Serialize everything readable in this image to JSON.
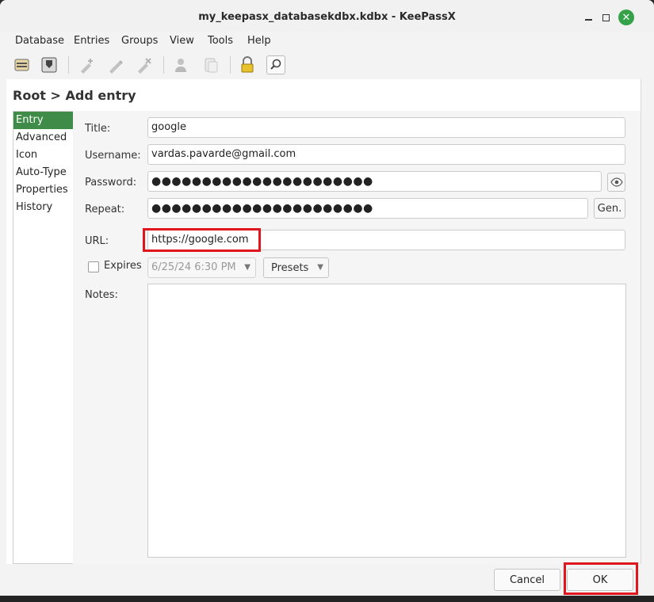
{
  "window": {
    "title": "my_keepasx_databasekdbx.kdbx - KeePassX"
  },
  "menubar": [
    "Database",
    "Entries",
    "Groups",
    "View",
    "Tools",
    "Help"
  ],
  "toolbar": {
    "icons": [
      "open-database-icon",
      "save-database-icon",
      "add-entry-icon",
      "edit-entry-icon",
      "delete-entry-icon",
      "copy-username-icon",
      "copy-password-icon",
      "lock-database-icon",
      "search-icon"
    ]
  },
  "breadcrumb": "Root > Add entry",
  "sidebar": {
    "items": [
      "Entry",
      "Advanced",
      "Icon",
      "Auto-Type",
      "Properties",
      "History"
    ],
    "selected": "Entry",
    "selected_color": "#3e8c47"
  },
  "form": {
    "title_label": "Title:",
    "title_value": "google",
    "username_label": "Username:",
    "username_value": "vardas.pavarde@gmail.com",
    "password_label": "Password:",
    "password_value": "●●●●●●●●●●●●●●●●●●●●●●",
    "repeat_label": "Repeat:",
    "repeat_value": "●●●●●●●●●●●●●●●●●●●●●●",
    "gen_label": "Gen.",
    "url_label": "URL:",
    "url_value": "https://google.com",
    "expires_label": "Expires",
    "expires_checked": false,
    "expires_value": "6/25/24 6:30 PM",
    "presets_label": "Presets",
    "notes_label": "Notes:",
    "notes_value": ""
  },
  "footer": {
    "cancel_label": "Cancel",
    "ok_label": "OK"
  },
  "colors": {
    "highlight": "#e0151e",
    "close_button": "#35a24a"
  }
}
